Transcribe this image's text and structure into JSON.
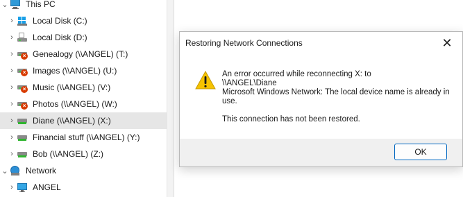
{
  "nav": {
    "items": [
      {
        "label": "This PC",
        "icon": "this-pc-icon",
        "expanded": true
      },
      {
        "label": "Local Disk (C:)",
        "icon": "windows-drive-icon"
      },
      {
        "label": "Local Disk (D:)",
        "icon": "drive-icon"
      },
      {
        "label": "Genealogy (\\\\ANGEL) (T:)",
        "icon": "disconnected-network-drive-icon"
      },
      {
        "label": "Images (\\\\ANGEL) (U:)",
        "icon": "disconnected-network-drive-icon"
      },
      {
        "label": "Music (\\\\ANGEL) (V:)",
        "icon": "disconnected-network-drive-icon"
      },
      {
        "label": "Photos (\\\\ANGEL) (W:)",
        "icon": "disconnected-network-drive-icon"
      },
      {
        "label": "Diane (\\\\ANGEL) (X:)",
        "icon": "network-drive-icon",
        "selected": true
      },
      {
        "label": "Financial stuff (\\\\ANGEL) (Y:)",
        "icon": "network-drive-icon"
      },
      {
        "label": "Bob (\\\\ANGEL) (Z:)",
        "icon": "network-drive-icon"
      },
      {
        "label": "Network",
        "icon": "network-icon",
        "expanded": true
      },
      {
        "label": "ANGEL",
        "icon": "computer-icon"
      }
    ]
  },
  "dialog": {
    "title": "Restoring Network Connections",
    "close_label": "✕",
    "message_line1": "An error occurred while reconnecting X: to",
    "message_line2": "\\\\ANGEL\\Diane",
    "message_line3": "Microsoft Windows Network: The local device name is already in use.",
    "message_line4": "This connection has not been restored.",
    "ok_label": "OK"
  }
}
